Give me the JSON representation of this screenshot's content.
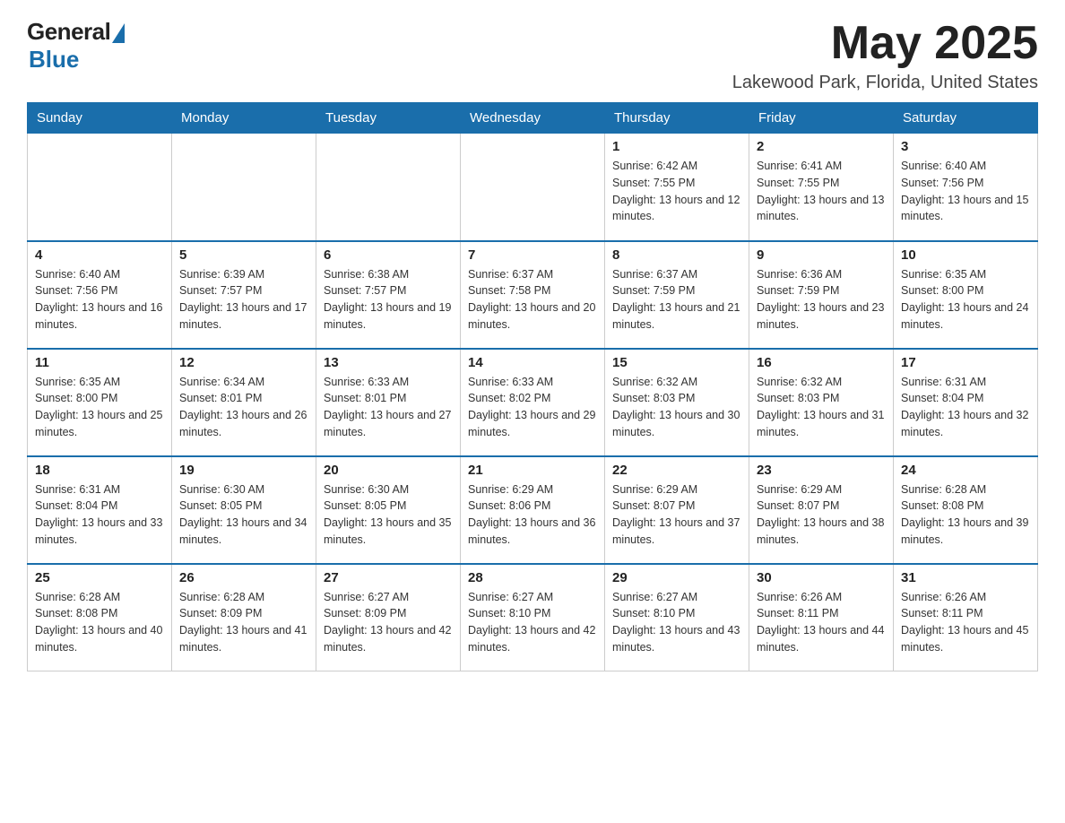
{
  "header": {
    "logo_general": "General",
    "logo_blue": "Blue",
    "month_title": "May 2025",
    "location": "Lakewood Park, Florida, United States"
  },
  "weekdays": [
    "Sunday",
    "Monday",
    "Tuesday",
    "Wednesday",
    "Thursday",
    "Friday",
    "Saturday"
  ],
  "weeks": [
    [
      {
        "day": "",
        "info": ""
      },
      {
        "day": "",
        "info": ""
      },
      {
        "day": "",
        "info": ""
      },
      {
        "day": "",
        "info": ""
      },
      {
        "day": "1",
        "info": "Sunrise: 6:42 AM\nSunset: 7:55 PM\nDaylight: 13 hours and 12 minutes."
      },
      {
        "day": "2",
        "info": "Sunrise: 6:41 AM\nSunset: 7:55 PM\nDaylight: 13 hours and 13 minutes."
      },
      {
        "day": "3",
        "info": "Sunrise: 6:40 AM\nSunset: 7:56 PM\nDaylight: 13 hours and 15 minutes."
      }
    ],
    [
      {
        "day": "4",
        "info": "Sunrise: 6:40 AM\nSunset: 7:56 PM\nDaylight: 13 hours and 16 minutes."
      },
      {
        "day": "5",
        "info": "Sunrise: 6:39 AM\nSunset: 7:57 PM\nDaylight: 13 hours and 17 minutes."
      },
      {
        "day": "6",
        "info": "Sunrise: 6:38 AM\nSunset: 7:57 PM\nDaylight: 13 hours and 19 minutes."
      },
      {
        "day": "7",
        "info": "Sunrise: 6:37 AM\nSunset: 7:58 PM\nDaylight: 13 hours and 20 minutes."
      },
      {
        "day": "8",
        "info": "Sunrise: 6:37 AM\nSunset: 7:59 PM\nDaylight: 13 hours and 21 minutes."
      },
      {
        "day": "9",
        "info": "Sunrise: 6:36 AM\nSunset: 7:59 PM\nDaylight: 13 hours and 23 minutes."
      },
      {
        "day": "10",
        "info": "Sunrise: 6:35 AM\nSunset: 8:00 PM\nDaylight: 13 hours and 24 minutes."
      }
    ],
    [
      {
        "day": "11",
        "info": "Sunrise: 6:35 AM\nSunset: 8:00 PM\nDaylight: 13 hours and 25 minutes."
      },
      {
        "day": "12",
        "info": "Sunrise: 6:34 AM\nSunset: 8:01 PM\nDaylight: 13 hours and 26 minutes."
      },
      {
        "day": "13",
        "info": "Sunrise: 6:33 AM\nSunset: 8:01 PM\nDaylight: 13 hours and 27 minutes."
      },
      {
        "day": "14",
        "info": "Sunrise: 6:33 AM\nSunset: 8:02 PM\nDaylight: 13 hours and 29 minutes."
      },
      {
        "day": "15",
        "info": "Sunrise: 6:32 AM\nSunset: 8:03 PM\nDaylight: 13 hours and 30 minutes."
      },
      {
        "day": "16",
        "info": "Sunrise: 6:32 AM\nSunset: 8:03 PM\nDaylight: 13 hours and 31 minutes."
      },
      {
        "day": "17",
        "info": "Sunrise: 6:31 AM\nSunset: 8:04 PM\nDaylight: 13 hours and 32 minutes."
      }
    ],
    [
      {
        "day": "18",
        "info": "Sunrise: 6:31 AM\nSunset: 8:04 PM\nDaylight: 13 hours and 33 minutes."
      },
      {
        "day": "19",
        "info": "Sunrise: 6:30 AM\nSunset: 8:05 PM\nDaylight: 13 hours and 34 minutes."
      },
      {
        "day": "20",
        "info": "Sunrise: 6:30 AM\nSunset: 8:05 PM\nDaylight: 13 hours and 35 minutes."
      },
      {
        "day": "21",
        "info": "Sunrise: 6:29 AM\nSunset: 8:06 PM\nDaylight: 13 hours and 36 minutes."
      },
      {
        "day": "22",
        "info": "Sunrise: 6:29 AM\nSunset: 8:07 PM\nDaylight: 13 hours and 37 minutes."
      },
      {
        "day": "23",
        "info": "Sunrise: 6:29 AM\nSunset: 8:07 PM\nDaylight: 13 hours and 38 minutes."
      },
      {
        "day": "24",
        "info": "Sunrise: 6:28 AM\nSunset: 8:08 PM\nDaylight: 13 hours and 39 minutes."
      }
    ],
    [
      {
        "day": "25",
        "info": "Sunrise: 6:28 AM\nSunset: 8:08 PM\nDaylight: 13 hours and 40 minutes."
      },
      {
        "day": "26",
        "info": "Sunrise: 6:28 AM\nSunset: 8:09 PM\nDaylight: 13 hours and 41 minutes."
      },
      {
        "day": "27",
        "info": "Sunrise: 6:27 AM\nSunset: 8:09 PM\nDaylight: 13 hours and 42 minutes."
      },
      {
        "day": "28",
        "info": "Sunrise: 6:27 AM\nSunset: 8:10 PM\nDaylight: 13 hours and 42 minutes."
      },
      {
        "day": "29",
        "info": "Sunrise: 6:27 AM\nSunset: 8:10 PM\nDaylight: 13 hours and 43 minutes."
      },
      {
        "day": "30",
        "info": "Sunrise: 6:26 AM\nSunset: 8:11 PM\nDaylight: 13 hours and 44 minutes."
      },
      {
        "day": "31",
        "info": "Sunrise: 6:26 AM\nSunset: 8:11 PM\nDaylight: 13 hours and 45 minutes."
      }
    ]
  ]
}
